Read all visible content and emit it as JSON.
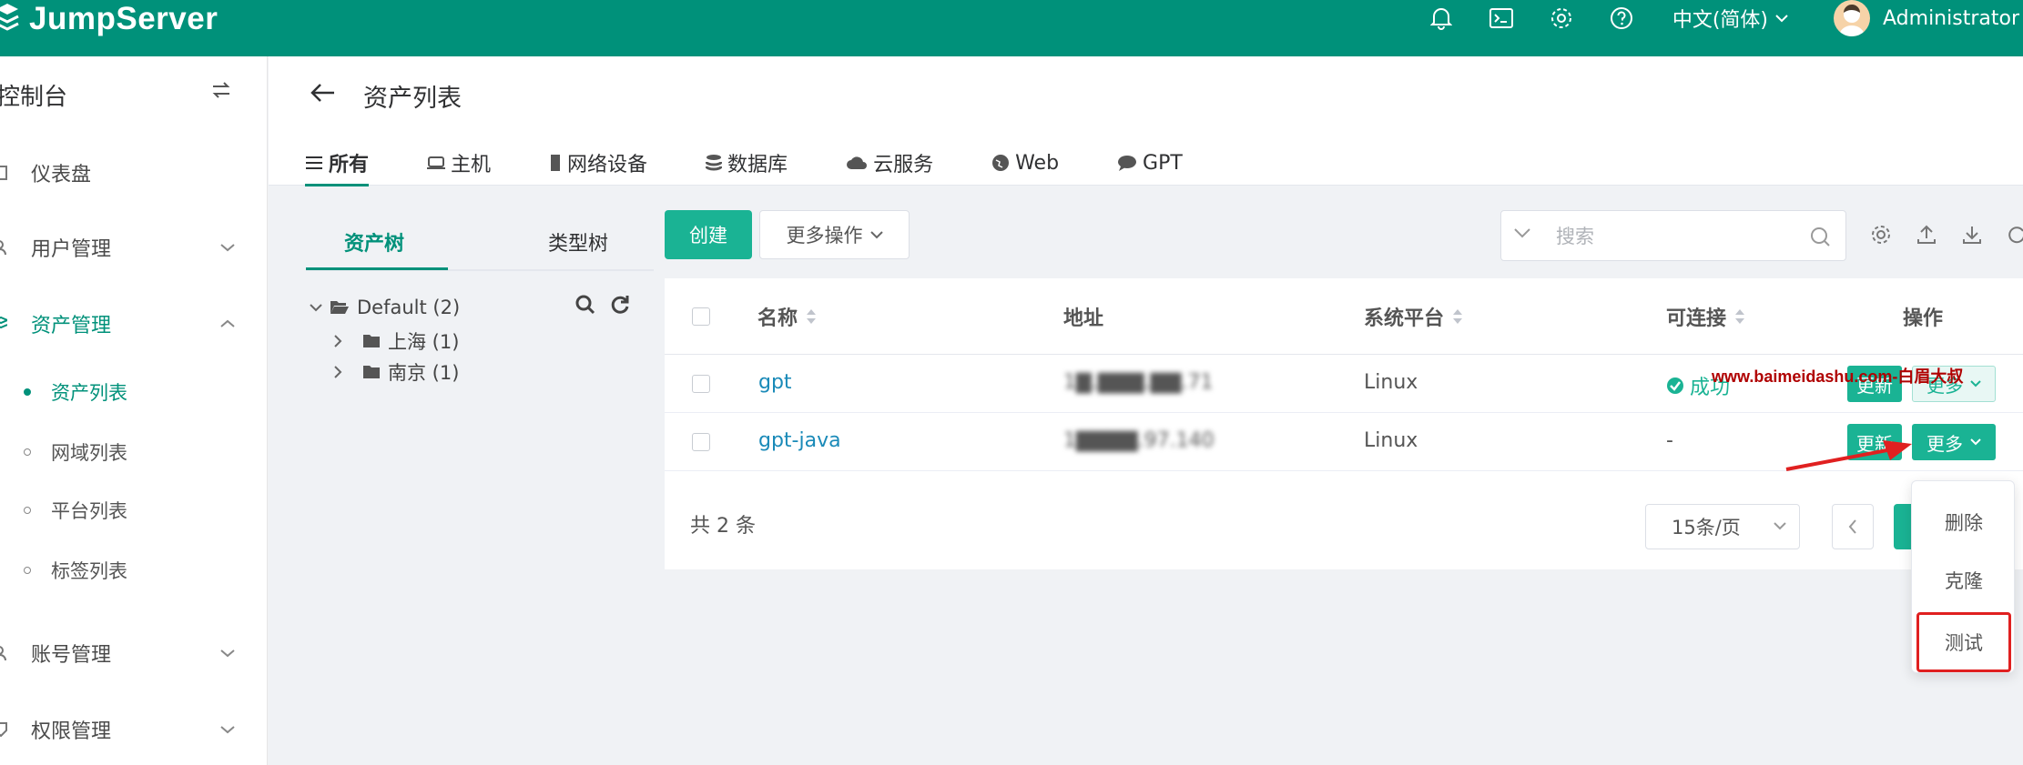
{
  "app": {
    "logo_text": "JumpServer",
    "brand_color": "#00917a",
    "accent_color": "#1ab394"
  },
  "header": {
    "icons": [
      "bell-icon",
      "terminal-icon",
      "gear-icon",
      "help-icon"
    ],
    "language": "中文(简体)",
    "username": "Administrator"
  },
  "sidebar": {
    "title": "控制台",
    "items": [
      {
        "label": "仪表盘",
        "icon": "dashboard-icon"
      },
      {
        "label": "用户管理",
        "icon": "user-icon"
      },
      {
        "label": "资产管理",
        "icon": "asset-icon"
      },
      {
        "label": "账号管理",
        "icon": "account-icon"
      },
      {
        "label": "权限管理",
        "icon": "permission-icon"
      }
    ],
    "subitems": [
      {
        "label": "资产列表",
        "active": true
      },
      {
        "label": "网域列表"
      },
      {
        "label": "平台列表"
      },
      {
        "label": "标签列表"
      }
    ]
  },
  "page": {
    "title": "资产列表",
    "tabs": [
      {
        "label": "所有",
        "icon": "list-icon"
      },
      {
        "label": "主机",
        "icon": "host-icon"
      },
      {
        "label": "网络设备",
        "icon": "device-icon"
      },
      {
        "label": "数据库",
        "icon": "database-icon"
      },
      {
        "label": "云服务",
        "icon": "cloud-icon"
      },
      {
        "label": "Web",
        "icon": "globe-icon"
      },
      {
        "label": "GPT",
        "icon": "chat-icon"
      }
    ]
  },
  "tree": {
    "tabs": [
      "资产树",
      "类型树"
    ],
    "root": "Default (2)",
    "children": [
      "上海 (1)",
      "南京 (1)"
    ]
  },
  "toolbar": {
    "create_label": "创建",
    "more_ops_label": "更多操作",
    "search_placeholder": "搜索"
  },
  "table": {
    "headers": [
      "名称",
      "地址",
      "系统平台",
      "可连接",
      "操作"
    ],
    "rows": [
      {
        "name": "gpt",
        "address": "1▇.▇▇▇.▇▇.71",
        "platform": "Linux",
        "status": "成功"
      },
      {
        "name": "gpt-java",
        "address": "1▇▇▇▇.97.140",
        "platform": "Linux",
        "status": "-"
      }
    ],
    "update_label": "更新",
    "more_label": "更多",
    "total": "共 2 条",
    "page_size": "15条/页"
  },
  "dropdown": {
    "items": [
      "删除",
      "克隆",
      "测试"
    ]
  },
  "watermark": "www.baimeidashu.com-白眉大叔"
}
